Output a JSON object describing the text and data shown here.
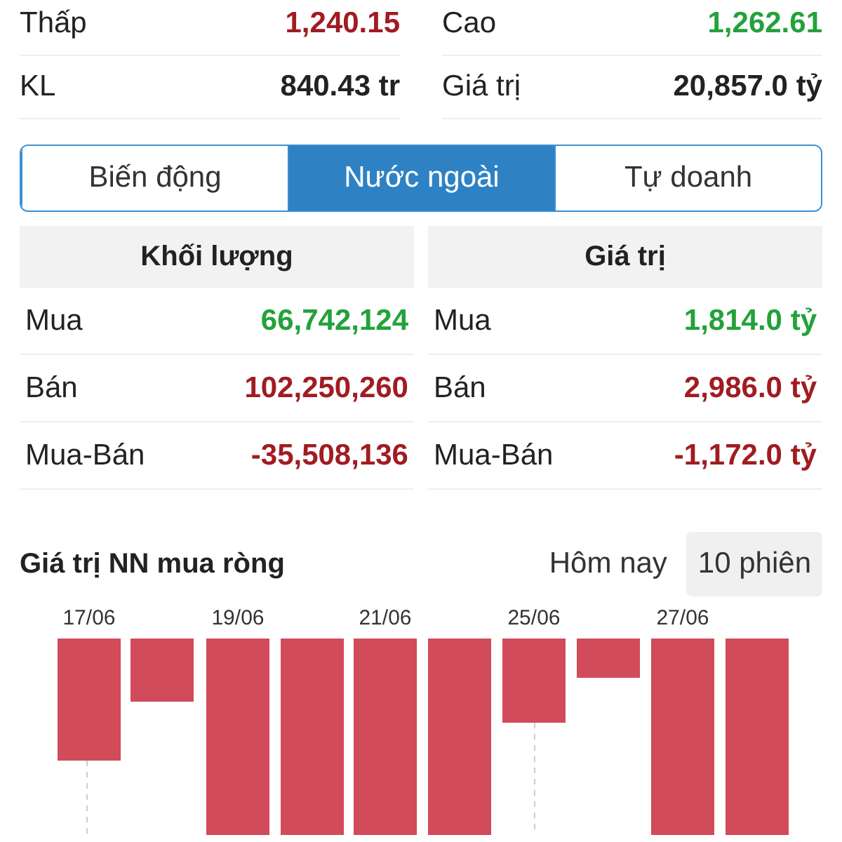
{
  "stats": [
    {
      "left": {
        "label": "Thấp",
        "value": "1,240.15",
        "color": "#a01c22"
      },
      "right": {
        "label": "Cao",
        "value": "1,262.61",
        "color": "#23a23a"
      }
    },
    {
      "left": {
        "label": "KL",
        "value": "840.43 tr",
        "color": "#222222"
      },
      "right": {
        "label": "Giá trị",
        "value": "20,857.0 tỷ",
        "color": "#222222"
      }
    }
  ],
  "tabs": [
    {
      "label": "Biến động",
      "selected": false
    },
    {
      "label": "Nước ngoài",
      "selected": true
    },
    {
      "label": "Tự doanh",
      "selected": false
    }
  ],
  "flow_tables": [
    {
      "title": "Khối lượng",
      "rows": [
        {
          "label": "Mua",
          "value": "66,742,124",
          "color": "#23a23a"
        },
        {
          "label": "Bán",
          "value": "102,250,260",
          "color": "#a01c22"
        },
        {
          "label": "Mua-Bán",
          "value": "-35,508,136",
          "color": "#a01c22"
        }
      ]
    },
    {
      "title": "Giá trị",
      "rows": [
        {
          "label": "Mua",
          "value": "1,814.0 tỷ",
          "color": "#23a23a"
        },
        {
          "label": "Bán",
          "value": "2,986.0 tỷ",
          "color": "#a01c22"
        },
        {
          "label": "Mua-Bán",
          "value": "-1,172.0 tỷ",
          "color": "#a01c22"
        }
      ]
    }
  ],
  "chart": {
    "title": "Giá trị NN mua ròng",
    "periods": [
      {
        "label": "Hôm nay",
        "selected": false
      },
      {
        "label": "10 phiên",
        "selected": true
      }
    ],
    "date_labels": [
      "17/06",
      "19/06",
      "21/06",
      "25/06",
      "27/06"
    ]
  }
}
